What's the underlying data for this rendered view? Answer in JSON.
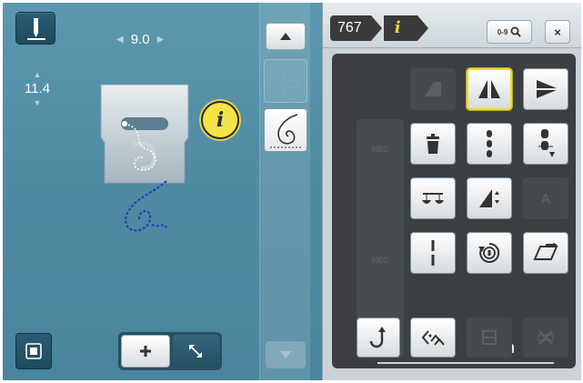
{
  "left_panel": {
    "stitch_width": "9.0",
    "stitch_length": "11.4",
    "info_label": "i"
  },
  "right_panel": {
    "pattern_number": "767",
    "info_tab": "i",
    "search_label": "0-9",
    "close_label": "×",
    "side_labels": [
      "REC",
      "",
      "REC",
      ""
    ],
    "font_tile": "A",
    "colors": {
      "selected_border": "#ECD93A",
      "info_yellow": "#F3E44A",
      "stitch_blue": "#1F3FB0"
    }
  },
  "icons": {
    "needle": "needle-position-icon",
    "mirror_horizontal": "mirror-left-right-icon",
    "mirror_vertical": "mirror-up-down-icon",
    "delete": "trash-icon",
    "balance": "balance-icon",
    "stitch_length_alt": "triangle-stepper-icon",
    "single_line": "straight-stitch-icon",
    "sequence_repeat": "repeat-icon",
    "parallelogram": "slant-parallelogram-icon",
    "back_return": "return-arrow-icon",
    "pattern_end": "pattern-end-icon"
  }
}
